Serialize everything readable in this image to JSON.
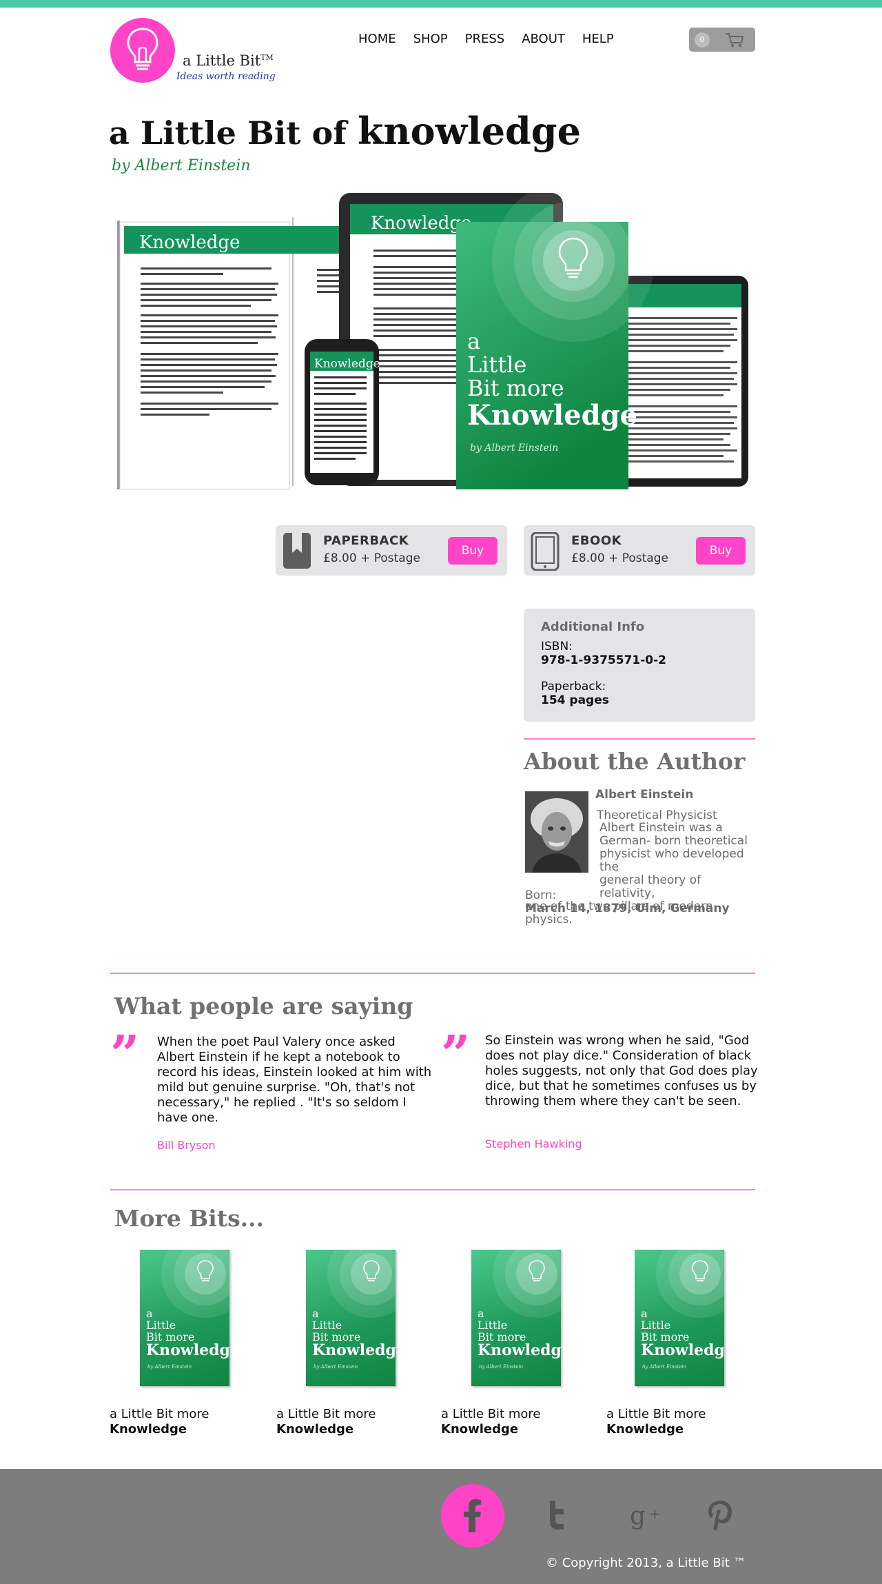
{
  "brand": {
    "name": "a Little Bit",
    "tm": "TM",
    "tagline": "Ideas worth reading",
    "pink": "#ff44c8",
    "green": "#1f9a5a",
    "teal": "#4ec9a8"
  },
  "nav": {
    "items": [
      "HOME",
      "SHOP",
      "PRESS",
      "ABOUT",
      "HELP"
    ]
  },
  "cart": {
    "count": "0",
    "icon": "cart-icon"
  },
  "product": {
    "title_prefix": "a Little Bit of",
    "title_bold": "knowledge",
    "byline": "by Albert Einstein",
    "hero": {
      "page_heading": "Knowledge",
      "cover_line1": "a",
      "cover_line2": "Little",
      "cover_line3": "Bit more",
      "cover_title": "Knowledge",
      "cover_author": "by Albert Einstein"
    }
  },
  "purchase": {
    "paperback": {
      "kind": "PAPERBACK",
      "price": "£8.00 + Postage",
      "button": "Buy",
      "icon": "bookmark-icon"
    },
    "ebook": {
      "kind": "EBOOK",
      "price": "£8.00 + Postage",
      "button": "Buy",
      "icon": "tablet-icon"
    }
  },
  "info": {
    "heading": "Additional Info",
    "isbn_label": "ISBN:",
    "isbn": "978-1-9375571-0-2",
    "format_label": "Paperback:",
    "pages": "154 pages"
  },
  "author": {
    "heading": "About the Author",
    "name": "Albert Einstein",
    "role": "Theoretical Physicist",
    "bio_indented": [
      "Albert Einstein was a",
      "German- born theoretical",
      "physicist who developed the",
      "general theory of relativity,"
    ],
    "bio_full": "one of the two pillars of modern physics.",
    "born_label": "Born:",
    "born": "March 14, 1879, Ulm, Germany"
  },
  "testimonials": {
    "heading": "What people are saying",
    "items": [
      {
        "text": "When the poet Paul Valery once asked Albert Einstein if he kept a notebook to record his ideas, Einstein looked at him with mild but genuine surprise. \"Oh, that's not necessary,\" he replied . \"It's so seldom I have one.",
        "author": "Bill Bryson"
      },
      {
        "text": "So Einstein was wrong when he said, \"God does not play dice.\" Consideration of black holes suggests, not only that God does play dice, but that he sometimes confuses us by throwing them where they can't be seen.",
        "author": "Stephen Hawking"
      }
    ]
  },
  "more": {
    "heading": "More Bits...",
    "books": [
      {
        "line1": "a Little Bit more",
        "line2": "Knowledge",
        "cover_a": "a",
        "cover_little": "Little",
        "cover_bitmore": "Bit more",
        "cover_title": "Knowledge",
        "cover_author": "by Albert Einstein"
      },
      {
        "line1": "a Little Bit more",
        "line2": "Knowledge",
        "cover_a": "a",
        "cover_little": "Little",
        "cover_bitmore": "Bit more",
        "cover_title": "Knowledge",
        "cover_author": "by Albert Einstein"
      },
      {
        "line1": "a Little Bit more",
        "line2": "Knowledge",
        "cover_a": "a",
        "cover_little": "Little",
        "cover_bitmore": "Bit more",
        "cover_title": "Knowledge",
        "cover_author": "by Albert Einstein"
      },
      {
        "line1": "a Little Bit more",
        "line2": "Knowledge",
        "cover_a": "a",
        "cover_little": "Little",
        "cover_bitmore": "Bit more",
        "cover_title": "Knowledge",
        "cover_author": "by Albert Einstein"
      }
    ]
  },
  "footer": {
    "social": [
      "facebook-icon",
      "twitter-icon",
      "google-plus-icon",
      "pinterest-icon"
    ],
    "copyright": "© Copyright 2013, a Little Bit ™"
  }
}
